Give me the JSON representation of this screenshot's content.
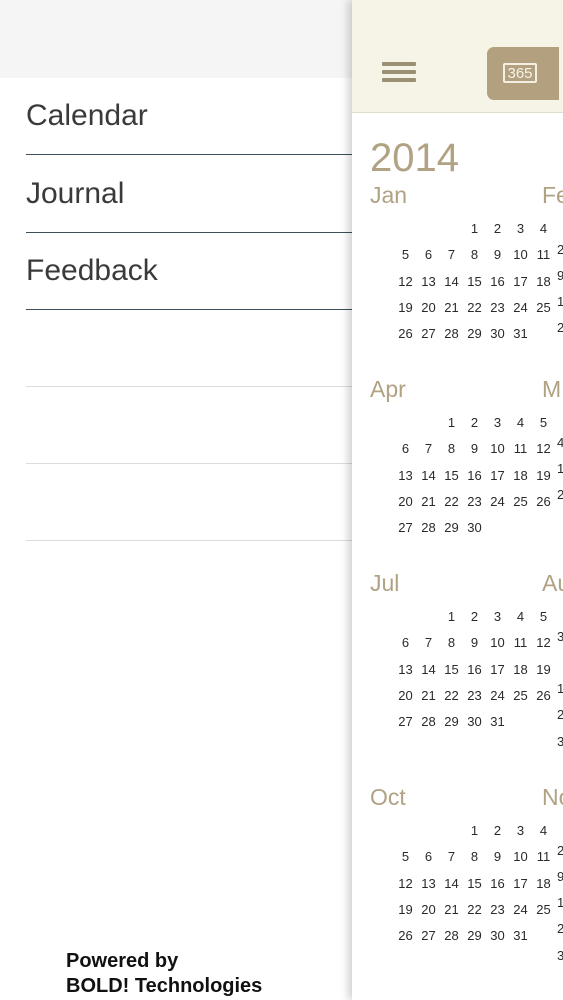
{
  "menu": {
    "items": [
      {
        "label": "Calendar"
      },
      {
        "label": "Journal"
      },
      {
        "label": "Feedback"
      }
    ],
    "powered_line1": "Powered by",
    "powered_line2": "BOLD! Technologies"
  },
  "toolbar": {
    "year_view_label": "365"
  },
  "calendar": {
    "year": "2014",
    "months": [
      {
        "name": "Jan",
        "start": 3,
        "days": 31
      },
      {
        "name": "Apr",
        "start": 2,
        "days": 30
      },
      {
        "name": "Jul",
        "start": 2,
        "days": 31
      },
      {
        "name": "Oct",
        "start": 3,
        "days": 31
      }
    ],
    "peek_months": [
      "Fe",
      "M",
      "Au",
      "No"
    ],
    "peek_days": [
      "2",
      "9",
      "1",
      "2",
      "4",
      "1",
      "2",
      "3",
      "1",
      "2",
      "3",
      "2",
      "9",
      "1",
      "2",
      "3"
    ]
  },
  "colors": {
    "accent": "#b0a283",
    "navbar_bg": "#f6f4e6",
    "segment_bg": "#b2a07f",
    "divider": "#3d4f5a"
  }
}
